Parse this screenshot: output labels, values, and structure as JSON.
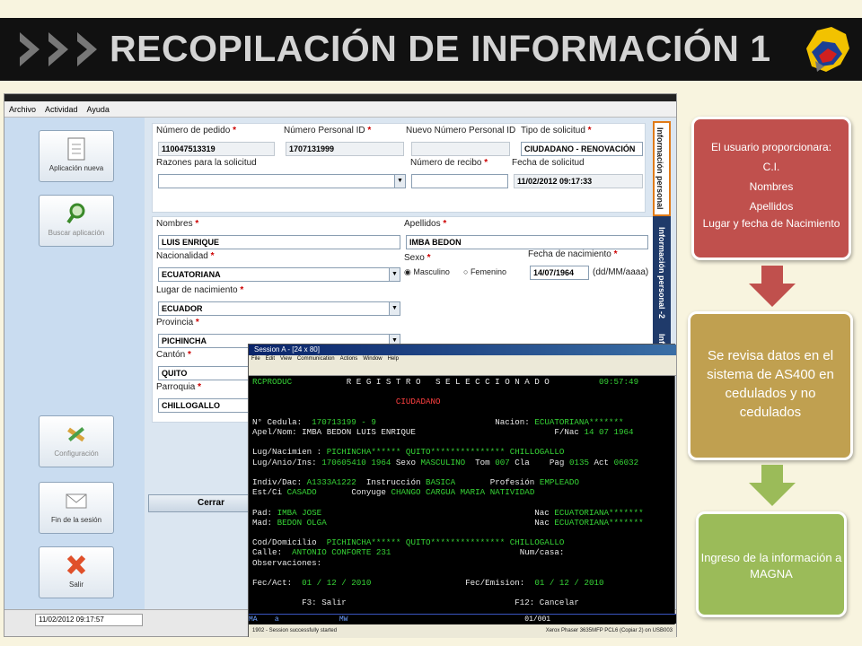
{
  "slide": {
    "title": "RECOPILACIÓN DE INFORMACIÓN 1",
    "logo_icon": "ecuador-map-logo",
    "arrows_icon": "triple-arrow-icon"
  },
  "app": {
    "menu": [
      "Archivo",
      "Actividad",
      "Ayuda"
    ],
    "nav": {
      "nueva": "Aplicación nueva",
      "buscar": "Buscar aplicación",
      "config": "Configuración",
      "fin": "Fin de la sesión",
      "salir": "Salir"
    },
    "form": {
      "numero_pedido_label": "Número de pedido",
      "numero_pedido": "110047513319",
      "numero_personal_label": "Número Personal ID",
      "numero_personal": "1707131999",
      "nuevo_numero_label": "Nuevo Número Personal ID",
      "tipo_solicitud_label": "Tipo de solicitud",
      "tipo_solicitud": "CIUDADANO - RENOVACIÓN",
      "razones_label": "Razones para la solicitud",
      "recibo_label": "Número de recibo",
      "fecha_solicitud_label": "Fecha de solicitud",
      "fecha_solicitud": "11/02/2012 09:17:33",
      "nombres_label": "Nombres",
      "nombres": "LUIS ENRIQUE",
      "apellidos_label": "Apellidos",
      "apellidos": "IMBA BEDON",
      "nacionalidad_label": "Nacionalidad",
      "nacionalidad": "ECUATORIANA",
      "sexo_label": "Sexo",
      "masculino": "Masculino",
      "femenino": "Femenino",
      "fecha_nac_label": "Fecha de nacimiento",
      "fecha_nac": "14/07/1964",
      "fecha_nac_hint": "(dd/MM/aaaa)",
      "lugar_nac_label": "Lugar de nacimiento",
      "lugar_nac": "ECUADOR",
      "provincia_label": "Provincia",
      "provincia": "PICHINCHA",
      "canton_label": "Cantón",
      "canton": "QUITO",
      "parroquia_label": "Parroquia",
      "parroquia": "CHILLOGALLO",
      "required_mark": "*"
    },
    "tabs": {
      "t1": "Información personal",
      "t2": "Información personal -2",
      "t3": "Info"
    },
    "cerrar": "Cerrar",
    "status_date": "11/02/2012 09:17:57"
  },
  "terminal": {
    "title": "Session A - [24 x 80]",
    "menu": [
      "File",
      "Edit",
      "View",
      "Communication",
      "Actions",
      "Window",
      "Help"
    ],
    "header_left": "RCPRODUC",
    "header_center": "R E G I S T R O   S E L E C C I O N A D O",
    "header_time": "09:57:49",
    "subtitle": "CIUDADANO",
    "cedula_label": "N° Cedula:",
    "cedula": "170713199 - 9",
    "nacion_label": "Nacion:",
    "nacion": "ECUATORIANA*******",
    "apel_label": "Apel/Nom:",
    "apel": "IMBA BEDON LUIS ENRIQUE",
    "fnac_label": "F/Nac",
    "fnac": "14 07 1964",
    "lugnac_label": "Lug/Nacimien :",
    "lugnac": "PICHINCHA****** QUITO*************** CHILLOGALLO",
    "luganio_label": "Lug/Anio/Ins:",
    "luganio": "170605410 1964",
    "sexo_label": "Sexo",
    "sexo": "MASCULINO",
    "tom_label": "Tom",
    "tom": "007",
    "cla_label": "Cla",
    "pag_label": "Pag",
    "pag": "0135",
    "act_label": "Act",
    "act": "06032",
    "indiv_label": "Indiv/Dac:",
    "indiv": "A1333A1222",
    "instr_label": "Instrucción",
    "instr": "BASICA",
    "prof_label": "Profesión",
    "prof": "EMPLEADO",
    "estci_label": "Est/Ci",
    "estci": "CASADO",
    "conyuge_label": "Conyuge",
    "conyuge": "CHANGO CARGUA MARIA NATIVIDAD",
    "pad_label": "Pad:",
    "pad": "IMBA JOSE",
    "nac_label": "Nac",
    "pad_nac": "ECUATORIANA*******",
    "mad_label": "Mad:",
    "mad": "BEDON OLGA",
    "mad_nac": "ECUATORIANA*******",
    "dom_label": "Cod/Domicilio",
    "dom": "PICHINCHA****** QUITO*************** CHILLOGALLO",
    "calle_label": "Calle:",
    "calle": "ANTONIO CONFORTE 231",
    "numcasa_label": "Num/casa:",
    "obs_label": "Observaciones:",
    "fecact_label": "Fec/Act:",
    "fecact": "01 / 12 / 2010",
    "fecemi_label": "Fec/Emision:",
    "fecemi": "01 / 12 / 2010",
    "f3": "F3: Salir",
    "f12": "F12: Cancelar",
    "oia_left": "MA",
    "oia_a": "a",
    "oia_mw": "MW",
    "oia_pos": "01/001",
    "status_left": "1902 - Session successfully started",
    "status_right": "Xerox Phaser 3635MFP PCL6 (Copiar 2) on USB003"
  },
  "flow": {
    "box1": [
      "El usuario proporcionara:",
      "C.I.",
      "Nombres",
      "Apellidos",
      "Lugar y fecha de Nacimiento"
    ],
    "box2": "Se revisa datos en el sistema de AS400 en cedulados y no cedulados",
    "box3": "Ingreso de la información a MAGNA",
    "colors": {
      "red": "#c0504d",
      "gold": "#c0a050",
      "green": "#9bbb59"
    }
  }
}
